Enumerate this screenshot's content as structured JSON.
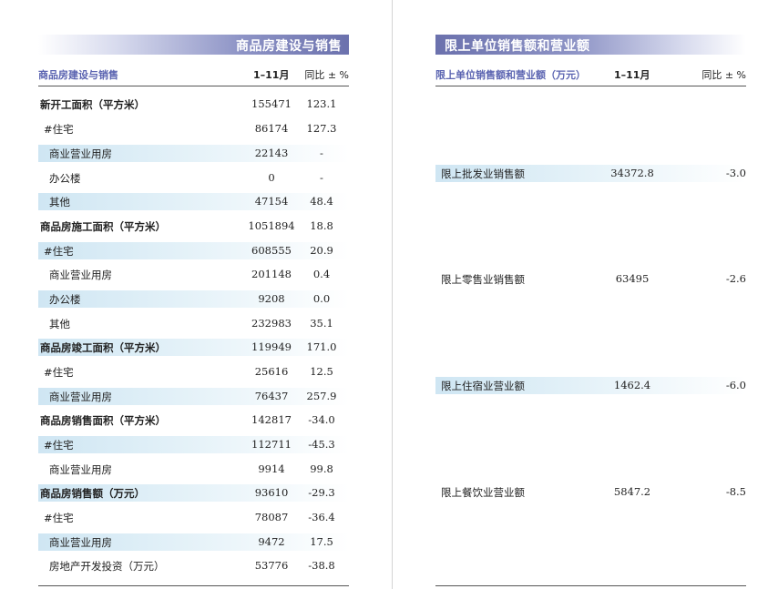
{
  "left": {
    "title": "商品房建设与销售",
    "header": {
      "label": "商品房建设与销售",
      "period": "1–11月",
      "yoy": "同比 ± %"
    },
    "rows": [
      {
        "label": "新开工面积（平方米）",
        "value": "155471",
        "yoy": "123.1"
      },
      {
        "label": "#住宅",
        "value": "86174",
        "yoy": "127.3"
      },
      {
        "label": "商业营业用房",
        "value": "22143",
        "yoy": "-"
      },
      {
        "label": "办公楼",
        "value": "0",
        "yoy": "-"
      },
      {
        "label": "其他",
        "value": "47154",
        "yoy": "48.4"
      },
      {
        "label": "商品房施工面积（平方米）",
        "value": "1051894",
        "yoy": "18.8"
      },
      {
        "label": "#住宅",
        "value": "608555",
        "yoy": "20.9"
      },
      {
        "label": "商业营业用房",
        "value": "201148",
        "yoy": "0.4"
      },
      {
        "label": "办公楼",
        "value": "9208",
        "yoy": "0.0"
      },
      {
        "label": "其他",
        "value": "232983",
        "yoy": "35.1"
      },
      {
        "label": "商品房竣工面积（平方米）",
        "value": "119949",
        "yoy": "171.0"
      },
      {
        "label": "#住宅",
        "value": "25616",
        "yoy": "12.5"
      },
      {
        "label": "商业营业用房",
        "value": "76437",
        "yoy": "257.9"
      },
      {
        "label": "商品房销售面积（平方米）",
        "value": "142817",
        "yoy": "-34.0"
      },
      {
        "label": "#住宅",
        "value": "112711",
        "yoy": "-45.3"
      },
      {
        "label": "商业营业用房",
        "value": "9914",
        "yoy": "99.8"
      },
      {
        "label": "商品房销售额（万元）",
        "value": "93610",
        "yoy": "-29.3"
      },
      {
        "label": "#住宅",
        "value": "78087",
        "yoy": "-36.4"
      },
      {
        "label": "商业营业用房",
        "value": "9472",
        "yoy": "17.5"
      },
      {
        "label": "房地产开发投资（万元）",
        "value": "53776",
        "yoy": "-38.8"
      }
    ]
  },
  "right": {
    "title": "限上单位销售额和营业额",
    "header": {
      "label": "限上单位销售额和营业额（万元）",
      "period": "1–11月",
      "yoy": "同比 ± %"
    },
    "rows": [
      {
        "label": "限上批发业销售额",
        "value": "34372.8",
        "yoy": "-3.0"
      },
      {
        "label": "限上零售业销售额",
        "value": "63495",
        "yoy": "-2.6"
      },
      {
        "label": "限上住宿业营业额",
        "value": "1462.4",
        "yoy": "-6.0"
      },
      {
        "label": "限上餐饮业营业额",
        "value": "5847.2",
        "yoy": "-8.5"
      }
    ]
  }
}
